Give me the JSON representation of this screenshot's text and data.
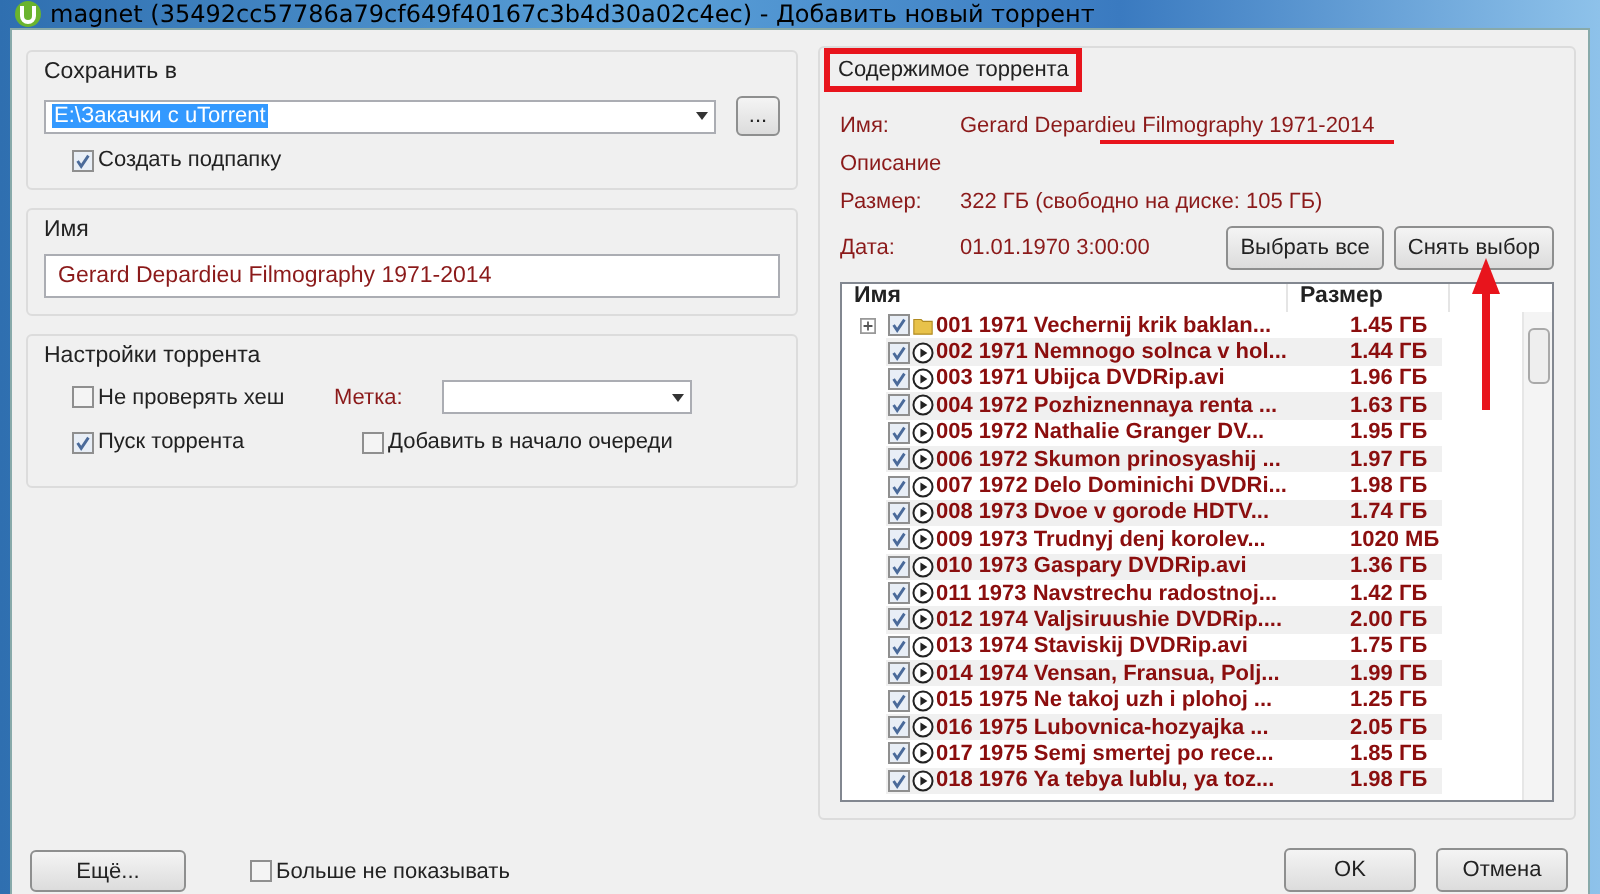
{
  "window": {
    "title": "magnet (35492cc57786a79cf649f40167c3b4d30a02c4ec) - Добавить новый торрент"
  },
  "save_to": {
    "label": "Сохранить в",
    "path": "E:\\Закачки с uTorrent",
    "browse": "...",
    "create_subfolder": {
      "label": "Создать подпапку",
      "checked": true
    }
  },
  "name_group": {
    "label": "Имя",
    "value": "Gerard Depardieu Filmography 1971-2014"
  },
  "settings": {
    "label": "Настройки торрента",
    "skip_hash": {
      "label": "Не проверять хеш",
      "checked": false
    },
    "start": {
      "label": "Пуск торрента",
      "checked": true
    },
    "tag_label": "Метка:",
    "add_to_top": {
      "label": "Добавить в начало очереди",
      "checked": false
    }
  },
  "contents": {
    "label": "Содержимое торрента",
    "info": [
      {
        "key": "Имя:",
        "value": "Gerard Depardieu Filmography 1971-2014"
      },
      {
        "key": "Описание"
      },
      {
        "key": "Размер:",
        "value": "322 ГБ (свободно на диске: 105 ГБ)"
      },
      {
        "key": "Дата:",
        "value": "01.01.1970 3:00:00"
      }
    ],
    "buttons": [
      "Выбрать все",
      "Снять выбор"
    ],
    "columns": [
      "Имя",
      "Размер"
    ],
    "files": [
      {
        "kind": "folder",
        "name": "001 1971 Vechernij krik baklan...",
        "size": "1.45 ГБ",
        "checked": true
      },
      {
        "kind": "video",
        "name": "002 1971 Nemnogo solnca v hol...",
        "size": "1.44 ГБ",
        "checked": true
      },
      {
        "kind": "video",
        "name": "003 1971 Ubijca DVDRip.avi",
        "size": "1.96 ГБ",
        "checked": true
      },
      {
        "kind": "video",
        "name": "004 1972 Pozhiznennaya renta ...",
        "size": "1.63 ГБ",
        "checked": true
      },
      {
        "kind": "video",
        "name": "005 1972 Nathalie Granger DV...",
        "size": "1.95 ГБ",
        "checked": true
      },
      {
        "kind": "video",
        "name": "006 1972 Skumon prinosyashij ...",
        "size": "1.97 ГБ",
        "checked": true
      },
      {
        "kind": "video",
        "name": "007 1972 Delo Dominichi DVDRi...",
        "size": "1.98 ГБ",
        "checked": true
      },
      {
        "kind": "video",
        "name": "008 1973 Dvoe v gorode HDTV...",
        "size": "1.74 ГБ",
        "checked": true
      },
      {
        "kind": "video",
        "name": "009 1973 Trudnyj denj korolev...",
        "size": "1020 МБ",
        "checked": true
      },
      {
        "kind": "video",
        "name": "010 1973 Gaspary DVDRip.avi",
        "size": "1.36 ГБ",
        "checked": true
      },
      {
        "kind": "video",
        "name": "011 1973 Navstrechu radostnoj...",
        "size": "1.42 ГБ",
        "checked": true
      },
      {
        "kind": "video",
        "name": "012 1974 Valjsiruushie DVDRip....",
        "size": "2.00 ГБ",
        "checked": true
      },
      {
        "kind": "video",
        "name": "013 1974 Staviskij DVDRip.avi",
        "size": "1.75 ГБ",
        "checked": true
      },
      {
        "kind": "video",
        "name": "014 1974 Vensan, Fransua, Polj...",
        "size": "1.99 ГБ",
        "checked": true
      },
      {
        "kind": "video",
        "name": "015 1975 Ne takoj uzh i plohoj ...",
        "size": "1.25 ГБ",
        "checked": true
      },
      {
        "kind": "video",
        "name": "016 1975 Lubovnica-hozyajka ...",
        "size": "2.05 ГБ",
        "checked": true
      },
      {
        "kind": "video",
        "name": "017 1975 Semj smertej po rece...",
        "size": "1.85 ГБ",
        "checked": true
      },
      {
        "kind": "video",
        "name": "018 1976 Ya tebya lublu, ya toz...",
        "size": "1.98 ГБ",
        "checked": true
      }
    ]
  },
  "footer": {
    "more": "Ещё...",
    "dont_show": {
      "label": "Больше не показывать",
      "checked": false
    },
    "ok": "OK",
    "cancel": "Отмена"
  }
}
